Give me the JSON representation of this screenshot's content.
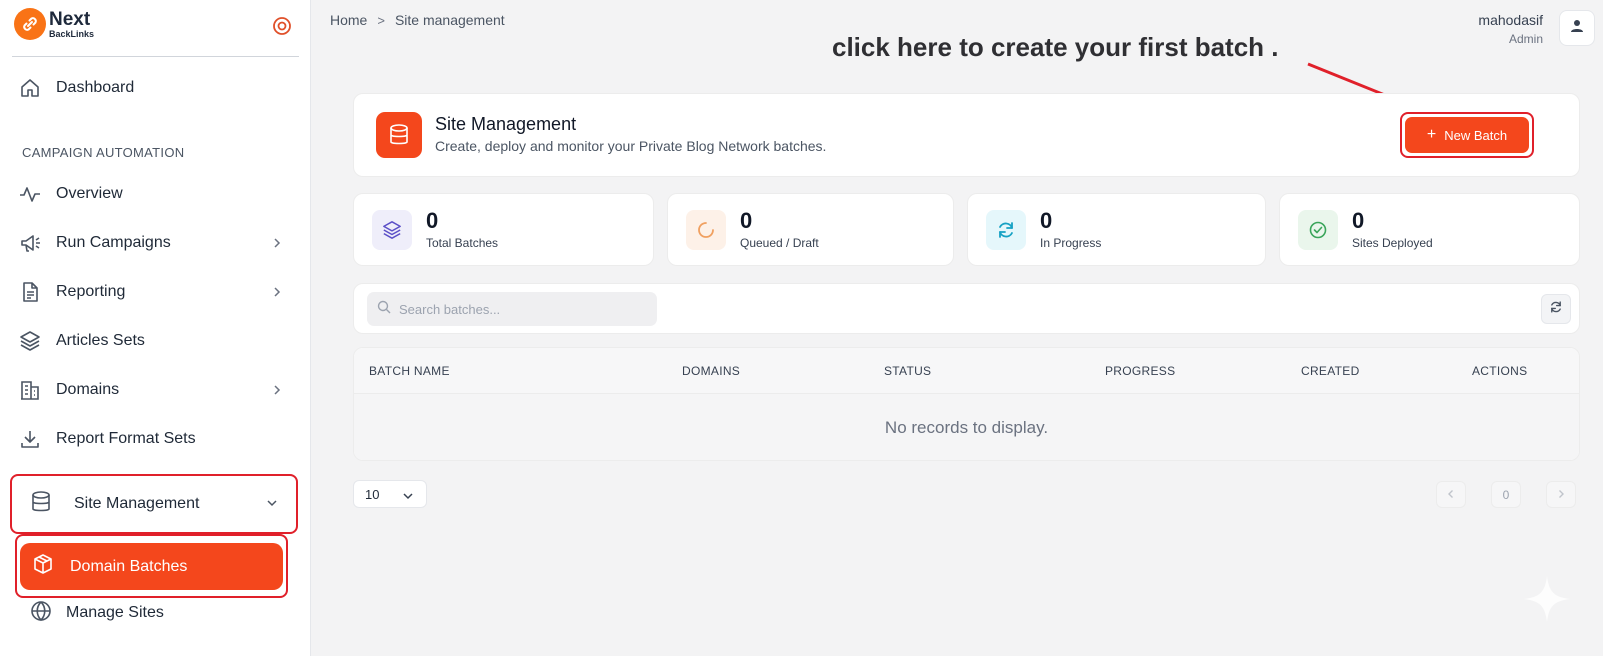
{
  "brand": {
    "name": "Next",
    "sub": "BackLinks"
  },
  "sidebar": {
    "dashboard": "Dashboard",
    "section": "CAMPAIGN AUTOMATION",
    "items": [
      {
        "label": "Overview"
      },
      {
        "label": "Run Campaigns"
      },
      {
        "label": "Reporting"
      },
      {
        "label": "Articles Sets"
      },
      {
        "label": "Domains"
      },
      {
        "label": "Report Format Sets"
      }
    ],
    "site_management": "Site Management",
    "domain_batches": "Domain Batches",
    "manage_sites": "Manage Sites"
  },
  "breadcrumb": {
    "home": "Home",
    "current": "Site management",
    "separator": ">"
  },
  "user": {
    "name": "mahodasif",
    "role": "Admin"
  },
  "annotation": "click here to create your first batch .",
  "header": {
    "title": "Site Management",
    "subtitle": "Create, deploy and monitor your Private Blog Network batches.",
    "new_batch": "New Batch"
  },
  "stats": [
    {
      "value": "0",
      "label": "Total Batches",
      "icon": "layers-icon"
    },
    {
      "value": "0",
      "label": "Queued / Draft",
      "icon": "spinner-icon"
    },
    {
      "value": "0",
      "label": "In Progress",
      "icon": "refresh-icon"
    },
    {
      "value": "0",
      "label": "Sites Deployed",
      "icon": "check-circle-icon"
    }
  ],
  "search": {
    "placeholder": "Search batches..."
  },
  "table": {
    "columns": [
      "BATCH NAME",
      "DOMAINS",
      "STATUS",
      "PROGRESS",
      "CREATED",
      "ACTIONS"
    ],
    "empty": "No records to display."
  },
  "pagination": {
    "page_size": "10",
    "page": "0"
  },
  "colors": {
    "accent": "#f4471c",
    "highlight_outline": "#e0202a",
    "stat_purple_bg": "#efeefa",
    "stat_orange_bg": "#fdf1e8",
    "stat_cyan_bg": "#e5f7fb",
    "stat_green_bg": "#eaf6ec"
  }
}
